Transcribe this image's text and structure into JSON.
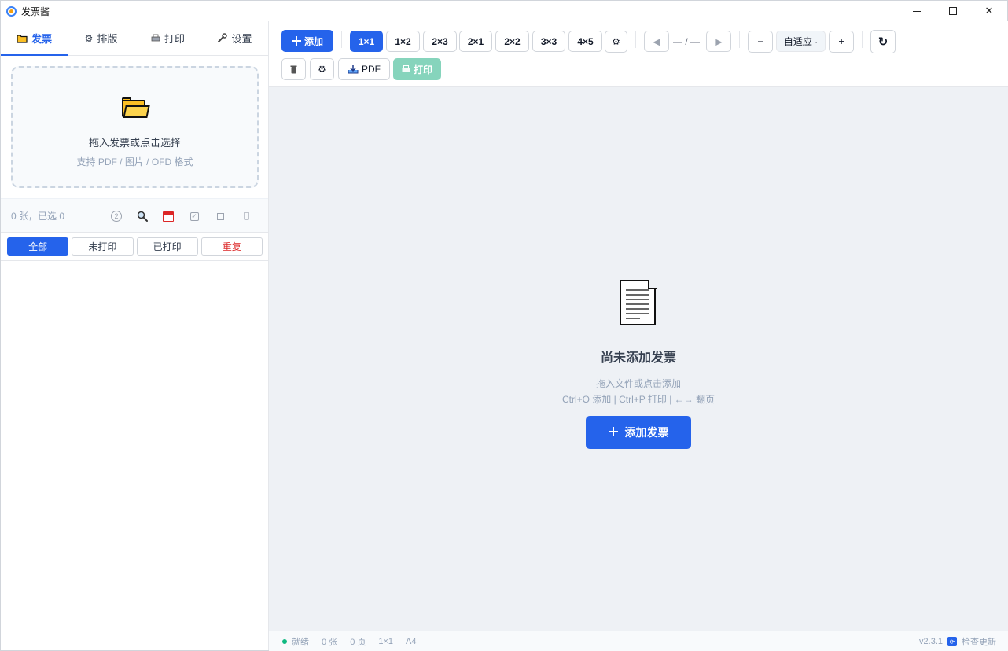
{
  "window": {
    "title": "发票酱",
    "minimize": "",
    "maximize": "",
    "close": "✕"
  },
  "sidebar": {
    "tabs": [
      {
        "icon": "folder-icon",
        "label": "发票"
      },
      {
        "icon": "gear-icon",
        "label": "排版"
      },
      {
        "icon": "printer-icon",
        "label": "打印"
      },
      {
        "icon": "wrench-icon",
        "label": "设置"
      }
    ],
    "dropzone": {
      "title": "拖入发票或点击选择",
      "subtitle": "支持 PDF / 图片 / OFD 格式"
    },
    "stats": "0 张，已选 0",
    "tools": {
      "help": "2",
      "check": "✓"
    },
    "filters": [
      "全部",
      "未打印",
      "已打印",
      "重复"
    ]
  },
  "toolbar": {
    "add_label": "添加",
    "layouts": [
      "1×1",
      "1×2",
      "2×3",
      "2×1",
      "2×2",
      "3×3",
      "4×5"
    ],
    "layout_settings": "⚙",
    "prev": "◀",
    "page_indicator": "— / —",
    "next": "▶",
    "zoom_out": "−",
    "zoom_value": "自适应 ·",
    "zoom_in": "+",
    "refresh": "↻",
    "clear_icon": "trash-icon",
    "settings_icon": "gear-icon",
    "pdf_label": "PDF",
    "print_label": "打印"
  },
  "empty_state": {
    "title": "尚未添加发票",
    "hint1": "拖入文件或点击添加",
    "hint2": "Ctrl+O 添加 | Ctrl+P 打印 | ←→ 翻页",
    "cta_label": "添加发票"
  },
  "statusbar": {
    "status": "就绪",
    "count": "0 张",
    "pages": "0 页",
    "layout": "1×1",
    "paper": "A4",
    "version": "v2.3.1",
    "update_label": "检查更新"
  },
  "colors": {
    "accent": "#2563eb",
    "print_disabled": "#86d4bc",
    "danger": "#dc2626",
    "status_ok": "#10b981"
  }
}
